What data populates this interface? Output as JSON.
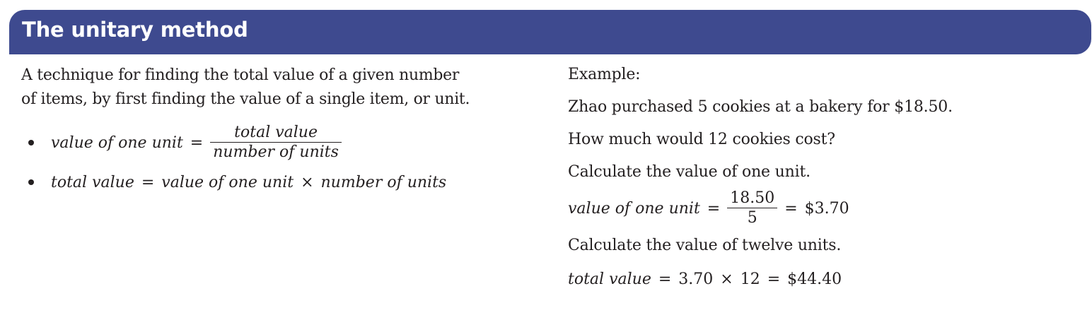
{
  "header": {
    "title": "The unitary method"
  },
  "definition": {
    "line1": "A technique for finding the total value of a given number",
    "line2": "of items, by first finding the value of a single item, or unit."
  },
  "formulas": {
    "f1_lhs": "value of one unit",
    "f1_eq": "=",
    "f1_num": "total value",
    "f1_den": "number of units",
    "f2_lhs": "total value",
    "f2_eq": "=",
    "f2_a": "value of one unit",
    "f2_times": "×",
    "f2_b": "number of units"
  },
  "example": {
    "label": "Example:",
    "problem1": "Zhao purchased 5 cookies at a bakery for $18.50.",
    "problem2": "How much would 12 cookies cost?",
    "step1": "Calculate the value of one unit.",
    "calc1_lhs": "value of one unit",
    "calc1_eq": "=",
    "calc1_num": "18.50",
    "calc1_den": "5",
    "calc1_eq2": "=",
    "calc1_result": "$3.70",
    "step2": "Calculate the value of twelve units.",
    "calc2_lhs": "total value",
    "calc2_eq": "=",
    "calc2_a": "3.70",
    "calc2_times": "×",
    "calc2_b": "12",
    "calc2_eq2": "=",
    "calc2_result": "$44.40"
  }
}
